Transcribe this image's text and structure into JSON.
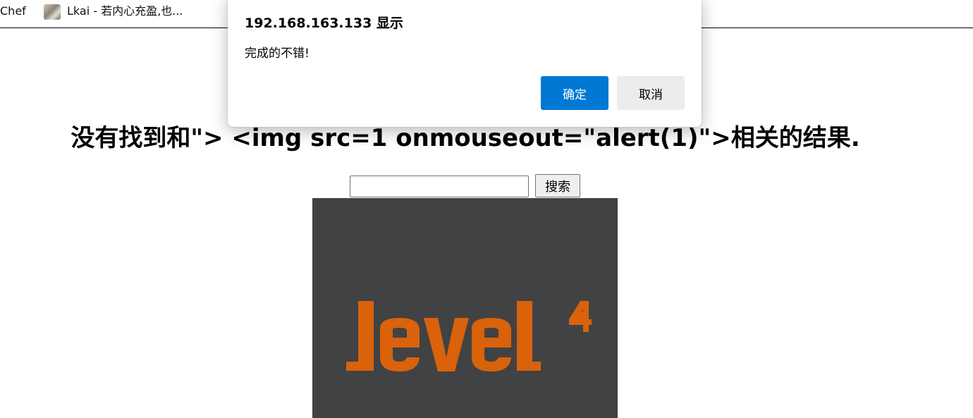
{
  "bookmarks": {
    "items": [
      {
        "label": "Chef"
      },
      {
        "label": "Lkai - 若内心充盈,也..."
      }
    ]
  },
  "page": {
    "heading": "没有找到和\"> <img src=1 onmouseout=\"alert(1)\">相关的结果.",
    "search": {
      "value": "",
      "placeholder": "",
      "button_label": "搜索"
    },
    "level_image": {
      "logo_text": "level4",
      "background_color": "#414243",
      "logo_color": "#d9620b"
    }
  },
  "alert": {
    "title": "192.168.163.133 显示",
    "message": "完成的不错!",
    "ok_label": "确定",
    "cancel_label": "取消",
    "accent_color": "#0078d4"
  }
}
